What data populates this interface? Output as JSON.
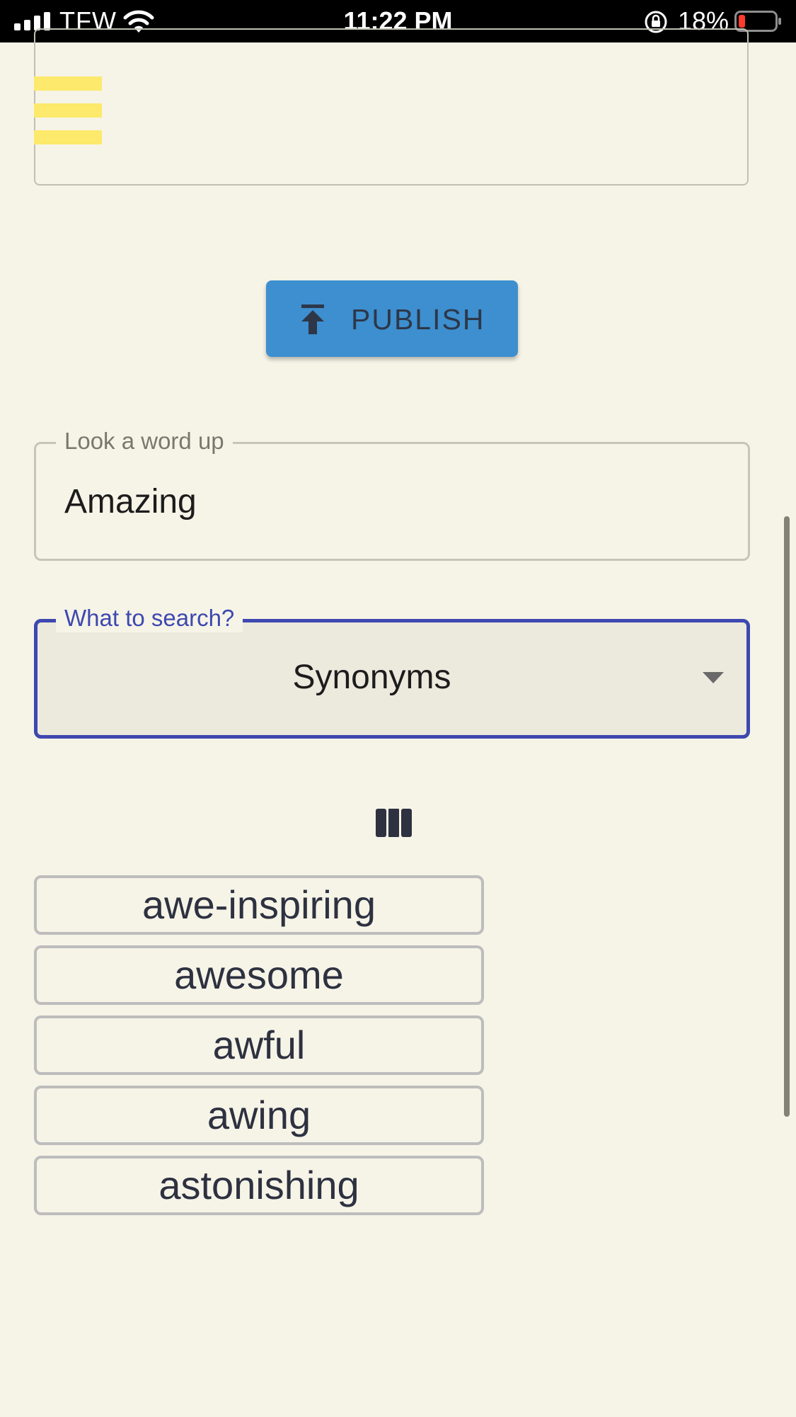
{
  "status_bar": {
    "carrier": "TFW",
    "time": "11:22 PM",
    "battery_percent": "18%",
    "battery_color": "#ff3b30",
    "icons": [
      "signal-icon",
      "wifi-icon",
      "rotation-lock-icon",
      "battery-icon"
    ]
  },
  "editor": {
    "menu_icon": "hamburger-menu-icon",
    "menu_icon_color": "#fde96b"
  },
  "publish_button": {
    "label": "PUBLISH",
    "icon": "upload-icon",
    "color": "#3d8fcf"
  },
  "lookup": {
    "label": "Look a word up",
    "value": "Amazing"
  },
  "search_type": {
    "label": "What to search?",
    "selected": "Synonyms",
    "accent_color": "#3e48b0"
  },
  "view_toggle": {
    "icon": "view-columns-icon"
  },
  "results": [
    "awe-inspiring",
    "awesome",
    "awful",
    "awing",
    "astonishing"
  ]
}
